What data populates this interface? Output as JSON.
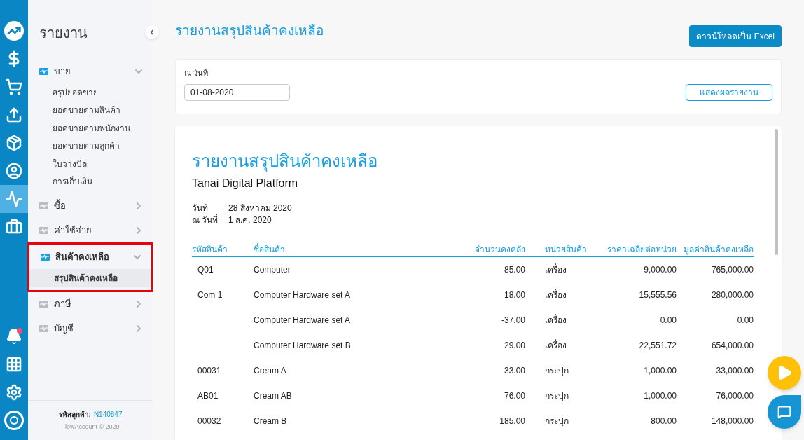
{
  "rail": {
    "top": [
      {
        "kind": "logo",
        "selected": false
      },
      {
        "kind": "dollar",
        "selected": false
      },
      {
        "kind": "cart",
        "selected": false
      },
      {
        "kind": "upload",
        "selected": false
      },
      {
        "kind": "box",
        "selected": false
      },
      {
        "kind": "user",
        "selected": false
      },
      {
        "kind": "report",
        "selected": true
      },
      {
        "kind": "briefcase",
        "selected": false
      }
    ],
    "bottom": [
      {
        "kind": "bell",
        "selected": false
      },
      {
        "kind": "apps",
        "selected": false
      },
      {
        "kind": "settings",
        "selected": false
      },
      {
        "kind": "brand",
        "selected": false
      }
    ]
  },
  "sidebar": {
    "title": "รายงาน",
    "groups": [
      {
        "label": "ขาย",
        "expanded": true,
        "selected": false,
        "highlighted": false,
        "items": [
          {
            "label": "สรุปยอดขาย",
            "selected": false
          },
          {
            "label": "ยอดขายตามสินค้า",
            "selected": false
          },
          {
            "label": "ยอดขายตามพนักงาน",
            "selected": false
          },
          {
            "label": "ยอดขายตามลูกค้า",
            "selected": false
          },
          {
            "label": "ใบวางบิล",
            "selected": false
          },
          {
            "label": "การเก็บเงิน",
            "selected": false
          }
        ]
      },
      {
        "label": "ซื้อ",
        "expanded": false,
        "selected": false,
        "highlighted": false
      },
      {
        "label": "ค่าใช้จ่าย",
        "expanded": false,
        "selected": false,
        "highlighted": false
      },
      {
        "label": "สินค้าคงเหลือ",
        "expanded": true,
        "selected": true,
        "highlighted": true,
        "items": [
          {
            "label": "สรุปสินค้าคงเหลือ",
            "selected": true
          }
        ]
      },
      {
        "label": "ภาษี",
        "expanded": false,
        "selected": false,
        "highlighted": false
      },
      {
        "label": "บัญชี",
        "expanded": false,
        "selected": false,
        "highlighted": false
      }
    ],
    "customer_label": "รหัสลูกค้า:",
    "customer_id": "N140847",
    "copyright": "FlowAccount © 2020"
  },
  "page": {
    "title": "รายงานสรุปสินค้าคงเหลือ",
    "download_button": "ดาวน์โหลดเป็น Excel"
  },
  "filter": {
    "label": "ณ วันที่:",
    "date": "01-08-2020",
    "show_button": "แสดงผลรายงาน"
  },
  "report": {
    "title": "รายงานสรุปสินค้าคงเหลือ",
    "company": "Tanai Digital Platform",
    "meta": [
      {
        "label": "วันที่",
        "value": "28 สิงหาคม 2020"
      },
      {
        "label": "ณ วันที่",
        "value": "1 ส.ค. 2020"
      }
    ],
    "columns": [
      "รหัสสินค้า",
      "ชื่อสินค้า",
      "จำนวนคงคลัง",
      "หน่วยสินค้า",
      "ราคาเฉลี่ยต่อหน่วย",
      "มูลค่าสินค้าคงเหลือ"
    ],
    "rows": [
      [
        "Q01",
        "Computer",
        "85.00",
        "เครื่อง",
        "9,000.00",
        "765,000.00"
      ],
      [
        "Com 1",
        "Computer Hardware set A",
        "18.00",
        "เครื่อง",
        "15,555.56",
        "280,000.00"
      ],
      [
        "",
        "Computer Hardware set A",
        "-37.00",
        "เครื่อง",
        "0.00",
        "0.00"
      ],
      [
        "",
        "Computer Hardware set B",
        "29.00",
        "เครื่อง",
        "22,551.72",
        "654,000.00"
      ],
      [
        "00031",
        "Cream A",
        "33.00",
        "กระปุก",
        "1,000.00",
        "33,000.00"
      ],
      [
        "AB01",
        "Cream AB",
        "76.00",
        "กระปุก",
        "1,000.00",
        "76,000.00"
      ],
      [
        "00032",
        "Cream B",
        "185.00",
        "กระปุก",
        "800.00",
        "148,000.00"
      ]
    ]
  }
}
